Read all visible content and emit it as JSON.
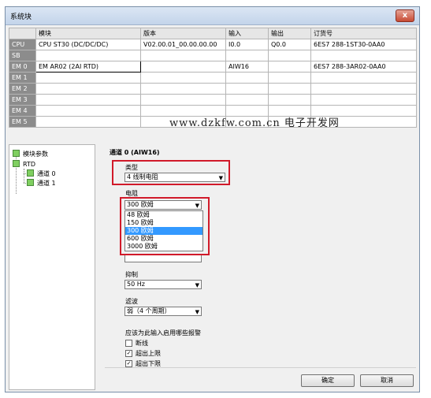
{
  "window": {
    "title": "系统块",
    "close_label": "x"
  },
  "table": {
    "headers": [
      "",
      "模块",
      "版本",
      "输入",
      "输出",
      "订货号"
    ],
    "rows": [
      {
        "slot": "CPU",
        "module": "CPU ST30 (DC/DC/DC)",
        "version": "V02.00.01_00.00.00.00",
        "input": "I0.0",
        "output": "Q0.0",
        "order": "6ES7 288-1ST30-0AA0"
      },
      {
        "slot": "SB",
        "module": "",
        "version": "",
        "input": "",
        "output": "",
        "order": ""
      },
      {
        "slot": "EM 0",
        "module": "EM AR02 (2AI RTD)",
        "version": "",
        "input": "AIW16",
        "output": "",
        "order": "6ES7 288-3AR02-0AA0"
      },
      {
        "slot": "EM 1",
        "module": "",
        "version": "",
        "input": "",
        "output": "",
        "order": ""
      },
      {
        "slot": "EM 2",
        "module": "",
        "version": "",
        "input": "",
        "output": "",
        "order": ""
      },
      {
        "slot": "EM 3",
        "module": "",
        "version": "",
        "input": "",
        "output": "",
        "order": ""
      },
      {
        "slot": "EM 4",
        "module": "",
        "version": "",
        "input": "",
        "output": "",
        "order": ""
      },
      {
        "slot": "EM 5",
        "module": "",
        "version": "",
        "input": "",
        "output": "",
        "order": ""
      }
    ]
  },
  "watermark": "www.dzkfw.com.cn  电子开发网",
  "tree": {
    "root": "模块参数",
    "group": "RTD",
    "children": [
      "通道 0",
      "通道 1"
    ]
  },
  "panel": {
    "title": "通道 0 (AIW16)",
    "type_label": "类型",
    "type_value": "4 线制电阻",
    "resistance_label": "电阻",
    "resistance_value": "300 欧姆",
    "resistance_options": [
      "48 欧姆",
      "150 欧姆",
      "300 欧姆",
      "600 欧姆",
      "3000 欧姆"
    ],
    "resistance_selected_index": 2,
    "suppress_label": "抑制",
    "suppress_value": "50 Hz",
    "filter_label": "滤波",
    "filter_value": "弱（4 个周期）",
    "alarm_label": "应该为此输入启用哪些报警",
    "alarms": [
      {
        "label": "断线",
        "checked": false
      },
      {
        "label": "超出上限",
        "checked": true
      },
      {
        "label": "超出下限",
        "checked": true
      }
    ]
  },
  "buttons": {
    "ok": "确定",
    "cancel": "取消"
  },
  "icons": {
    "dropdown_arrow": "dropdown-arrow-icon",
    "tree_checkbox": "tree-checkbox-icon"
  }
}
